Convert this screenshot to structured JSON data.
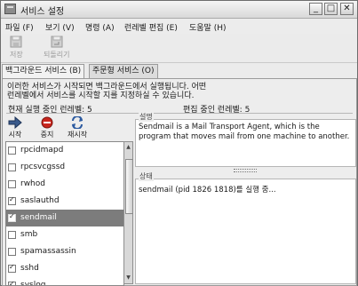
{
  "window": {
    "title": "서비스 설정"
  },
  "menu": [
    "파일 (F)",
    "보기 (V)",
    "명령 (A)",
    "런레벨 편집 (E)",
    "도움말 (H)"
  ],
  "toolbar": {
    "save": "저장",
    "revert": "되돌리기"
  },
  "tabs": [
    "백그라운드 서비스 (B)",
    "주문형 서비스 (O)"
  ],
  "description": {
    "line1": "이러한 서비스가 시작되면 백그라운드에서 실행됩니다. 어떤",
    "line2": "런레벨에서 서비스를 시작할 지를 지정하실 수 있습니다."
  },
  "counts": {
    "current": "현재 실행 중인 런레벨: 5",
    "editing": "편집 중인 런레벨: 5"
  },
  "actions": {
    "start": "시작",
    "stop": "중지",
    "restart": "재시작"
  },
  "services": [
    {
      "name": "rpcidmapd",
      "checked": false
    },
    {
      "name": "rpcsvcgssd",
      "checked": false
    },
    {
      "name": "rwhod",
      "checked": false
    },
    {
      "name": "saslauthd",
      "checked": true
    },
    {
      "name": "sendmail",
      "checked": true,
      "selected": true
    },
    {
      "name": "smb",
      "checked": false
    },
    {
      "name": "spamassassin",
      "checked": false
    },
    {
      "name": "sshd",
      "checked": true
    },
    {
      "name": "syslog",
      "checked": true
    }
  ],
  "info": {
    "label": "설명",
    "text": "Sendmail is a Mail Transport Agent, which is the program that moves mail from one machine to another."
  },
  "status": {
    "label": "상태",
    "text": "sendmail (pid 1826 1818)를 실행 중..."
  }
}
